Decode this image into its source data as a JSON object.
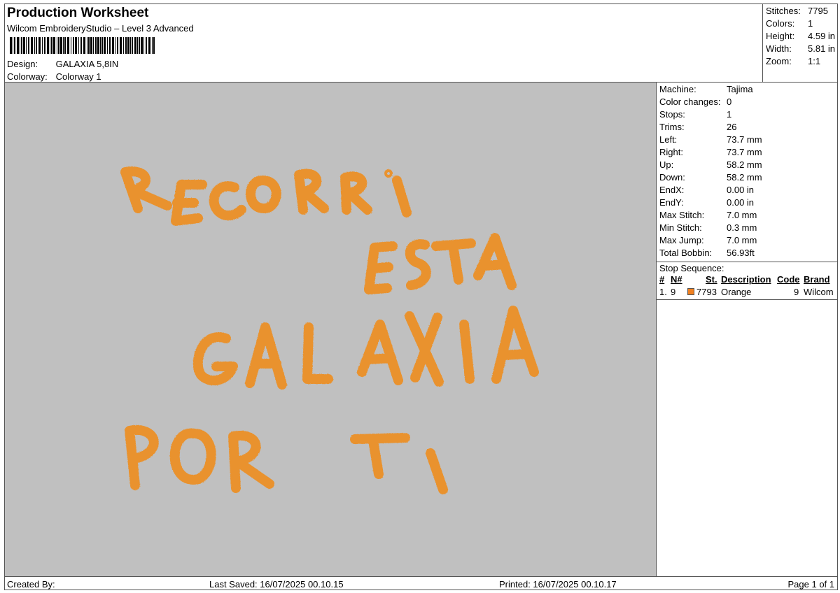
{
  "header": {
    "title": "Production Worksheet",
    "subtitle": "Wilcom EmbroideryStudio – Level 3 Advanced",
    "design_label": "Design:",
    "design_value": "GALAXIA 5,8IN",
    "colorway_label": "Colorway:",
    "colorway_value": "Colorway 1"
  },
  "summary": {
    "stitches_label": "Stitches:",
    "stitches_value": "7795",
    "colors_label": "Colors:",
    "colors_value": "1",
    "height_label": "Height:",
    "height_value": "4.59 in",
    "width_label": "Width:",
    "width_value": "5.81 in",
    "zoom_label": "Zoom:",
    "zoom_value": "1:1"
  },
  "design_preview": {
    "lines": [
      "RECORRI",
      "ESTA",
      "GALAXIA",
      "POR TI"
    ],
    "thread_color": "#e9922e",
    "background_color": "#c0c0c0"
  },
  "machine_info": [
    {
      "label": "Machine:",
      "value": "Tajima"
    },
    {
      "label": "Color changes:",
      "value": "0"
    },
    {
      "label": "Stops:",
      "value": "1"
    },
    {
      "label": "Trims:",
      "value": "26"
    },
    {
      "label": "Left:",
      "value": "73.7 mm"
    },
    {
      "label": "Right:",
      "value": "73.7 mm"
    },
    {
      "label": "Up:",
      "value": "58.2 mm"
    },
    {
      "label": "Down:",
      "value": "58.2 mm"
    },
    {
      "label": "EndX:",
      "value": "0.00 in"
    },
    {
      "label": "EndY:",
      "value": "0.00 in"
    },
    {
      "label": "Max Stitch:",
      "value": "7.0 mm"
    },
    {
      "label": "Min Stitch:",
      "value": "0.3 mm"
    },
    {
      "label": "Max Jump:",
      "value": "7.0 mm"
    },
    {
      "label": "Total Bobbin:",
      "value": "56.93ft"
    }
  ],
  "stop_sequence": {
    "title": "Stop Sequence:",
    "headers": {
      "num": "#",
      "n": "N#",
      "st": "St.",
      "description": "Description",
      "code": "Code",
      "brand": "Brand"
    },
    "rows": [
      {
        "num": "1.",
        "n": "9",
        "st": "7793",
        "description": "Orange",
        "code": "9",
        "brand": "Wilcom",
        "color": "#f08020"
      }
    ]
  },
  "footer": {
    "created_by": "Created By:",
    "last_saved": "Last Saved: 16/07/2025 00.10.15",
    "printed": "Printed: 16/07/2025 00.10.17",
    "page": "Page 1 of 1"
  }
}
